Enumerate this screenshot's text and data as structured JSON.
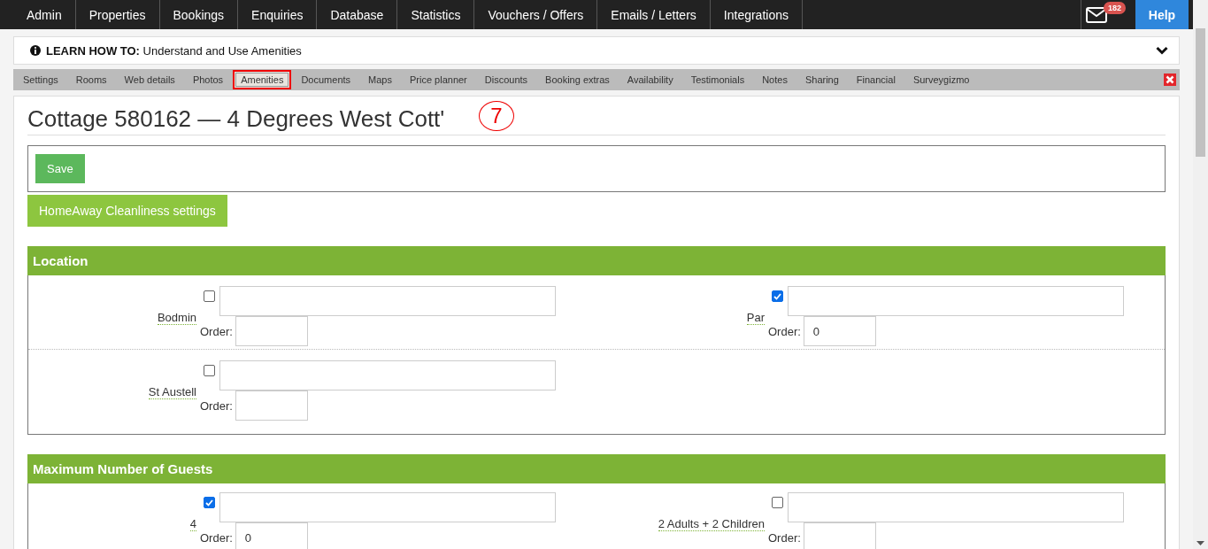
{
  "nav": {
    "items": [
      {
        "label": "Admin"
      },
      {
        "label": "Properties"
      },
      {
        "label": "Bookings"
      },
      {
        "label": "Enquiries"
      },
      {
        "label": "Database"
      },
      {
        "label": "Statistics"
      },
      {
        "label": "Vouchers / Offers"
      },
      {
        "label": "Emails / Letters"
      },
      {
        "label": "Integrations"
      }
    ],
    "mail_badge": "182",
    "help": "Help"
  },
  "learn": {
    "text": "**LEARN HOW TO:** Understand and Use Amenities"
  },
  "tabs": [
    {
      "label": "Settings",
      "selected": false
    },
    {
      "label": "Rooms",
      "selected": false
    },
    {
      "label": "Web details",
      "selected": false
    },
    {
      "label": "Photos",
      "selected": false
    },
    {
      "label": "Amenities",
      "selected": true
    },
    {
      "label": "Documents",
      "selected": false
    },
    {
      "label": "Maps",
      "selected": false
    },
    {
      "label": "Price planner",
      "selected": false
    },
    {
      "label": "Discounts",
      "selected": false
    },
    {
      "label": "Booking extras",
      "selected": false
    },
    {
      "label": "Availability",
      "selected": false
    },
    {
      "label": "Testimonials",
      "selected": false
    },
    {
      "label": "Notes",
      "selected": false
    },
    {
      "label": "Sharing",
      "selected": false
    },
    {
      "label": "Financial",
      "selected": false
    },
    {
      "label": "Surveygizmo",
      "selected": false
    }
  ],
  "annotation": "7",
  "title": "Cottage 580162 — 4 Degrees West Cott'",
  "save": "Save",
  "homeaway": "HomeAway Cleanliness settings",
  "sections": [
    {
      "title": "Location",
      "rows": [
        [
          {
            "label": "Bodmin",
            "checked": false,
            "order_label": "Order:"
          },
          {
            "label": "Par",
            "checked": true,
            "order_label": "Order:",
            "order": "0"
          }
        ],
        [
          {
            "label": "St Austell",
            "checked": false,
            "order_label": "Order:"
          }
        ]
      ]
    },
    {
      "title": "Maximum Number of Guests",
      "rows": [
        [
          {
            "label": "4",
            "checked": true,
            "order_label": "Order:",
            "order": "0"
          },
          {
            "label": "2 Adults + 2 Children",
            "checked": false,
            "order_label": "Order:"
          }
        ]
      ]
    }
  ]
}
